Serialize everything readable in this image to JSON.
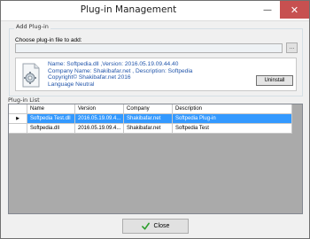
{
  "window": {
    "title": "Plug-in Management",
    "min_glyph": "—",
    "close_glyph": "✕"
  },
  "add_plugin": {
    "group_title": "Add Plug-in",
    "choose_label": "Choose plug-in file to add:",
    "file_value": "",
    "browse_label": "...",
    "info": {
      "line1": "Name: Softpedia.dll ,Version: 2016.05.19.09.44.40",
      "line2": "Company Name: Shakibafar.net , Description: Softpedia",
      "line3": "Copyright© Shakibafar.net 2016",
      "line4": "Language Neutral"
    },
    "uninstall_label": "Uninstall",
    "icon": "plugin-file-icon"
  },
  "plugin_list": {
    "title": "Plug-in List",
    "columns": [
      "Name",
      "Version",
      "Company",
      "Description"
    ],
    "rows": [
      {
        "name": "Softpedia Test.dll",
        "version": "2016.05.19.09.4...",
        "company": "Shakibafar.net",
        "description": "Softpedia Plug-in",
        "selected": true
      },
      {
        "name": "Softpedia.dll",
        "version": "2016.05.19.09.4...",
        "company": "Shakibafar.net",
        "description": "Softpedia Test",
        "selected": false
      }
    ],
    "current_row_glyph": "▶"
  },
  "footer": {
    "close_label": "Close",
    "close_icon": "check-icon"
  },
  "colors": {
    "selection": "#3399ff",
    "info_text": "#2255aa",
    "grid_background": "#aaaaaa"
  }
}
